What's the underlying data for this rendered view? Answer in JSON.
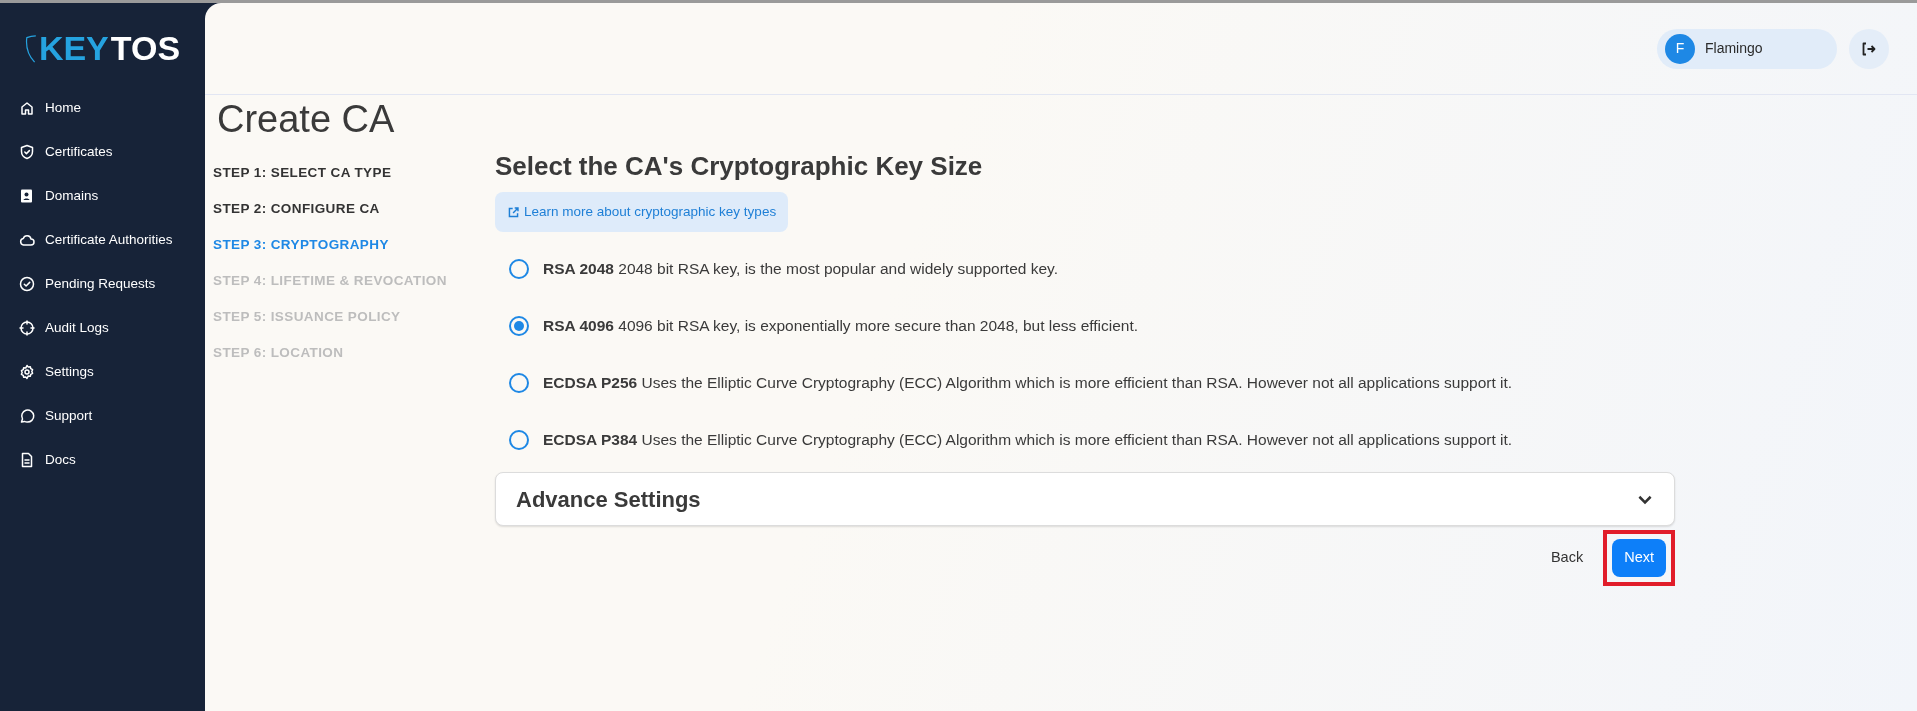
{
  "sidebar": {
    "logo": {
      "accent": "KEY",
      "rest": "TOS"
    },
    "items": [
      {
        "label": "Home"
      },
      {
        "label": "Certificates"
      },
      {
        "label": "Domains"
      },
      {
        "label": "Certificate Authorities"
      },
      {
        "label": "Pending Requests"
      },
      {
        "label": "Audit Logs"
      },
      {
        "label": "Settings"
      },
      {
        "label": "Support"
      },
      {
        "label": "Docs"
      }
    ]
  },
  "header": {
    "user": {
      "initial": "F",
      "name": "Flamingo"
    }
  },
  "page": {
    "title": "Create CA",
    "steps": [
      {
        "label": "STEP 1: SELECT CA TYPE",
        "selected": false,
        "disabled": false
      },
      {
        "label": "STEP 2: CONFIGURE CA",
        "selected": false,
        "disabled": false
      },
      {
        "label": "STEP 3: CRYPTOGRAPHY",
        "selected": true,
        "disabled": false
      },
      {
        "label": "STEP 4: LIFETIME & REVOCATION",
        "selected": false,
        "disabled": true
      },
      {
        "label": "STEP 5: ISSUANCE POLICY",
        "selected": false,
        "disabled": true
      },
      {
        "label": "STEP 6: LOCATION",
        "selected": false,
        "disabled": true
      }
    ],
    "heading": "Select the CA's Cryptographic Key Size",
    "learn_link": "Learn more about cryptographic key types",
    "options": [
      {
        "text": "**RSA 2048** 2048 bit RSA key, is the most popular and widely supported key.",
        "selected": false
      },
      {
        "text": "**RSA 4096** 4096 bit RSA key, is exponentially more secure than 2048, but less efficient.",
        "selected": true
      },
      {
        "text": "**ECDSA P256** Uses the Elliptic Curve Cryptography (ECC) Algorithm which is more efficient than RSA. However not all applications support it.",
        "selected": false
      },
      {
        "text": "**ECDSA P384** Uses the Elliptic Curve Cryptography (ECC) Algorithm which is more efficient than RSA. However not all applications support it.",
        "selected": false
      }
    ],
    "advanced": {
      "title": "Advance Settings",
      "expanded": false
    },
    "back_button": "Back",
    "next_button": {
      "label": "Next",
      "highlighted": true
    }
  }
}
